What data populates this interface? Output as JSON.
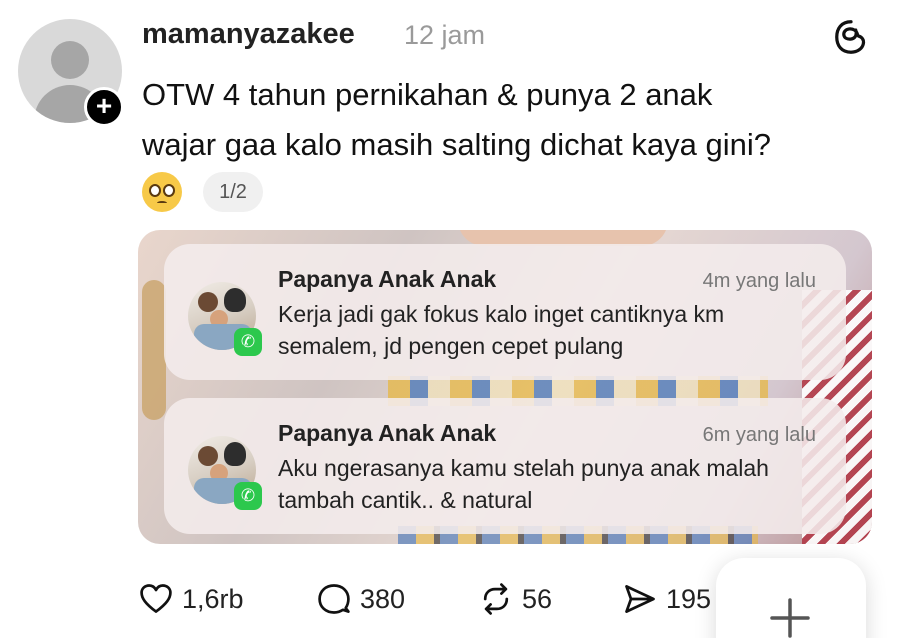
{
  "post": {
    "username": "mamanyazakee",
    "timestamp": "12 jam",
    "text_line1": "OTW 4 tahun pernikahan & punya 2 anak",
    "text_line2": "wajar gaa kalo masih salting dichat kaya gini?",
    "reaction_emoji": "pleading-face-emoji",
    "page_indicator": "1/2"
  },
  "notifications": [
    {
      "sender": "Papanya Anak Anak",
      "time": "4m yang lalu",
      "message": "Kerja jadi gak fokus kalo inget cantiknya km semalem, jd pengen cepet pulang",
      "app_icon": "whatsapp-icon"
    },
    {
      "sender": "Papanya Anak Anak",
      "time": "6m yang lalu",
      "message": "Aku ngerasanya kamu stelah punya anak malah tambah cantik.. & natural",
      "app_icon": "whatsapp-icon"
    }
  ],
  "actions": {
    "likes": "1,6rb",
    "replies": "380",
    "reposts": "56",
    "shares": "195"
  },
  "icons": {
    "app_logo": "threads-logo-icon",
    "follow": "plus-icon",
    "like": "heart-icon",
    "reply": "speech-bubble-icon",
    "repost": "repost-icon",
    "share": "send-icon",
    "compose": "plus-icon"
  },
  "colors": {
    "whatsapp": "#2cc84d",
    "timestamp_gray": "#9a9a9a"
  }
}
